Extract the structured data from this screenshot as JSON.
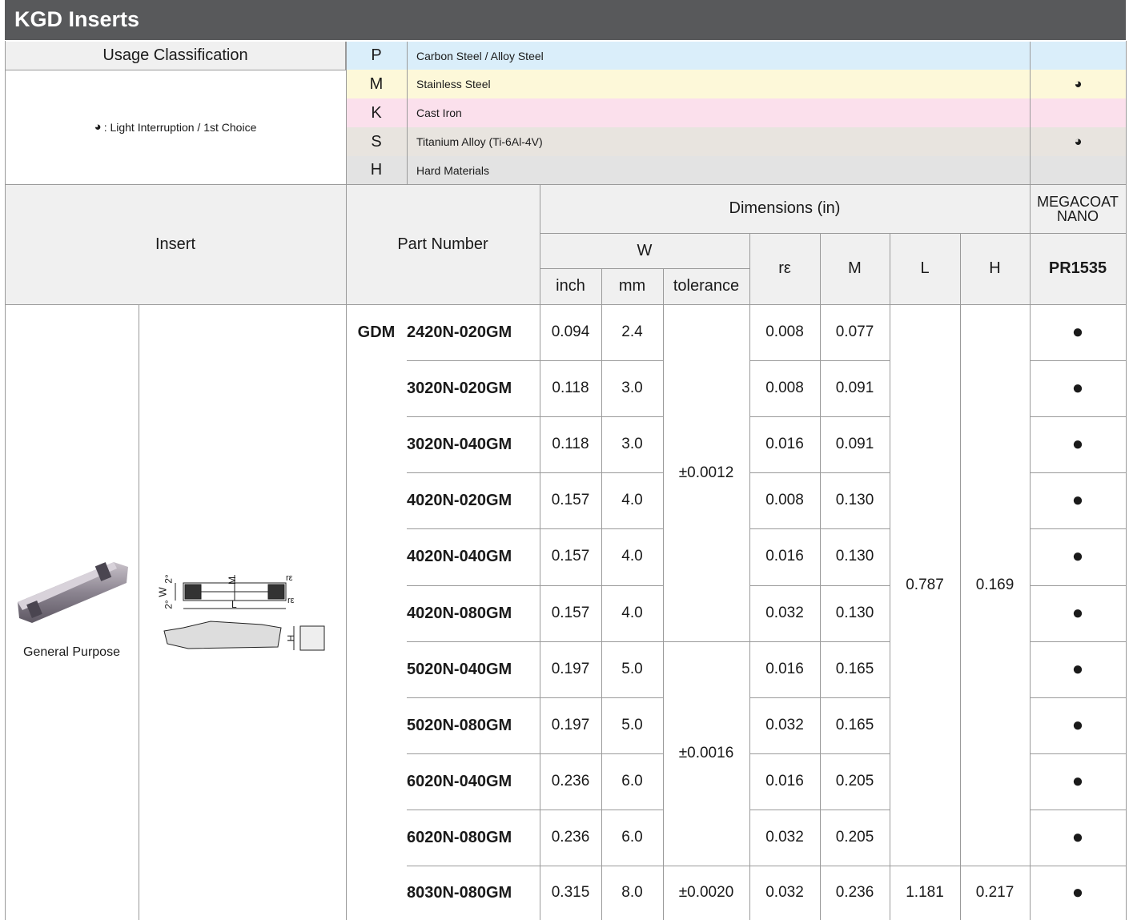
{
  "title": "KGD Inserts",
  "usage": {
    "label": "Usage Classification",
    "legend_symbol": "◕",
    "legend_text": ": Light Interruption / 1st Choice",
    "rows": [
      {
        "code": "P",
        "material": "Carbon Steel / Alloy Steel",
        "mark": "",
        "color": "#daeefa"
      },
      {
        "code": "M",
        "material": "Stainless Steel",
        "mark": "◕",
        "color": "#fdf8d9"
      },
      {
        "code": "K",
        "material": "Cast Iron",
        "mark": "",
        "color": "#fbe0ec"
      },
      {
        "code": "S",
        "material": "Titanium Alloy (Ti-6Al-4V)",
        "mark": "◕",
        "color": "#e8e4df"
      },
      {
        "code": "H",
        "material": "Hard Materials",
        "mark": "",
        "color": "#e3e3e3"
      }
    ]
  },
  "header": {
    "insert": "Insert",
    "part_number": "Part Number",
    "dimensions": "Dimensions (in)",
    "w": "W",
    "inch": "inch",
    "mm": "mm",
    "tolerance": "tolerance",
    "re": "rε",
    "m": "M",
    "l": "L",
    "h": "H",
    "grade_line1": "MEGACOAT",
    "grade_line2": "NANO",
    "grade": "PR1535"
  },
  "insert_image_caption": "General Purpose",
  "diagram_labels": {
    "w": "W",
    "m": "M",
    "l": "L",
    "h": "H",
    "re_top": "rε",
    "re_bottom": "rε",
    "angle_top": "2°",
    "angle_bottom": "2°"
  },
  "prefix": "GDM",
  "rows": [
    {
      "part": "2420N-020GM",
      "inch": "0.094",
      "mm": "2.4",
      "re": "0.008",
      "m": "0.077",
      "mark": "●"
    },
    {
      "part": "3020N-020GM",
      "inch": "0.118",
      "mm": "3.0",
      "re": "0.008",
      "m": "0.091",
      "mark": "●"
    },
    {
      "part": "3020N-040GM",
      "inch": "0.118",
      "mm": "3.0",
      "re": "0.016",
      "m": "0.091",
      "mark": "●"
    },
    {
      "part": "4020N-020GM",
      "inch": "0.157",
      "mm": "4.0",
      "re": "0.008",
      "m": "0.130",
      "mark": "●"
    },
    {
      "part": "4020N-040GM",
      "inch": "0.157",
      "mm": "4.0",
      "re": "0.016",
      "m": "0.130",
      "mark": "●"
    },
    {
      "part": "4020N-080GM",
      "inch": "0.157",
      "mm": "4.0",
      "re": "0.032",
      "m": "0.130",
      "mark": "●"
    },
    {
      "part": "5020N-040GM",
      "inch": "0.197",
      "mm": "5.0",
      "re": "0.016",
      "m": "0.165",
      "mark": "●"
    },
    {
      "part": "5020N-080GM",
      "inch": "0.197",
      "mm": "5.0",
      "re": "0.032",
      "m": "0.165",
      "mark": "●"
    },
    {
      "part": "6020N-040GM",
      "inch": "0.236",
      "mm": "6.0",
      "re": "0.016",
      "m": "0.205",
      "mark": "●"
    },
    {
      "part": "6020N-080GM",
      "inch": "0.236",
      "mm": "6.0",
      "re": "0.032",
      "m": "0.205",
      "mark": "●"
    },
    {
      "part": "8030N-080GM",
      "inch": "0.315",
      "mm": "8.0",
      "re": "0.032",
      "m": "0.236",
      "mark": "●"
    }
  ],
  "merged": {
    "tol_1": "±0.0012",
    "tol_2": "±0.0016",
    "tol_3": "±0.0020",
    "l_1": "0.787",
    "h_1": "0.169",
    "l_2": "1.181",
    "h_2": "0.217"
  }
}
